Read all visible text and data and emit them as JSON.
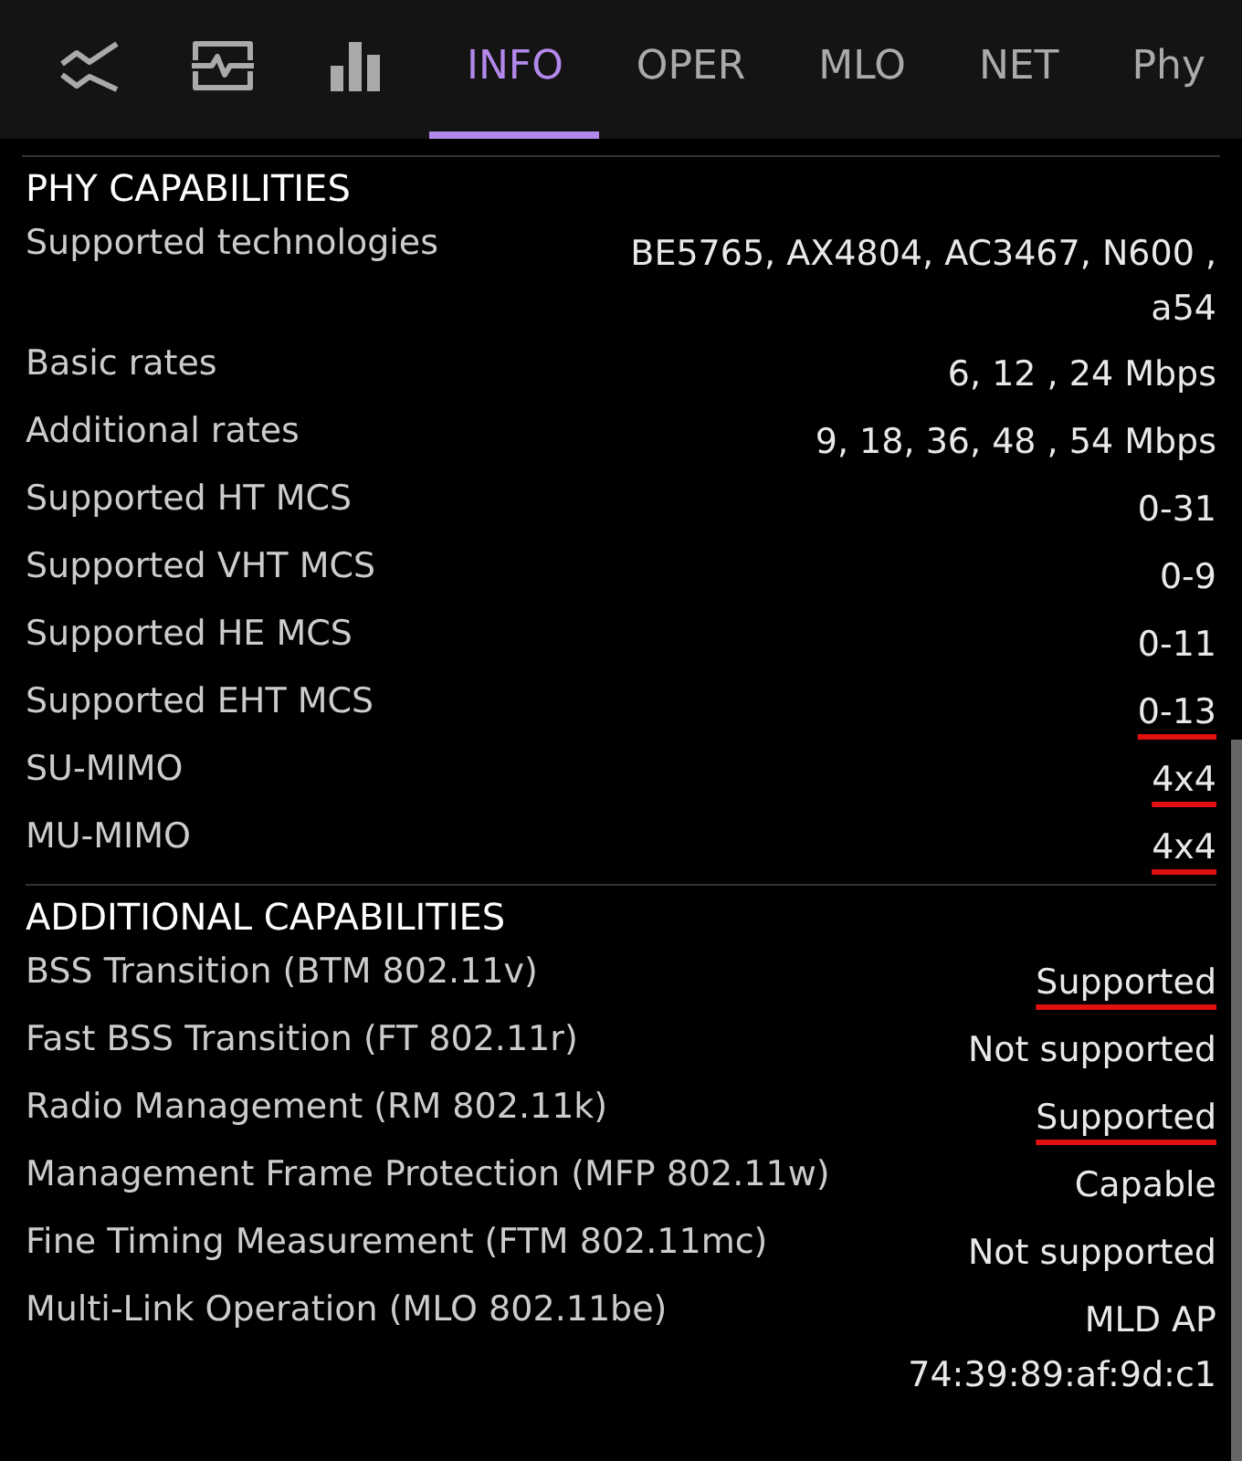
{
  "tabs": [
    {
      "kind": "waves",
      "selected": false
    },
    {
      "kind": "pulse",
      "selected": false
    },
    {
      "kind": "bars",
      "selected": false
    },
    {
      "kind": "text",
      "label": "INFO",
      "selected": true
    },
    {
      "kind": "text",
      "label": "OPER",
      "selected": false
    },
    {
      "kind": "text",
      "label": "MLO",
      "selected": false
    },
    {
      "kind": "text",
      "label": "NET",
      "selected": false
    },
    {
      "kind": "text",
      "label": "Phy",
      "selected": false
    }
  ],
  "sections": [
    {
      "title": "PHY CAPABILITIES",
      "rows": [
        {
          "label": "Supported technologies",
          "values": [
            "BE5765, AX4804, AC3467, N600 , a54"
          ],
          "highlighted": false
        },
        {
          "label": "Basic rates",
          "values": [
            "6, 12 , 24 Mbps"
          ],
          "highlighted": false
        },
        {
          "label": "Additional rates",
          "values": [
            "9, 18, 36, 48 , 54 Mbps"
          ],
          "highlighted": false
        },
        {
          "label": "Supported HT MCS",
          "values": [
            "0-31"
          ],
          "highlighted": false
        },
        {
          "label": "Supported VHT MCS",
          "values": [
            "0-9"
          ],
          "highlighted": false
        },
        {
          "label": "Supported HE MCS",
          "values": [
            "0-11"
          ],
          "highlighted": false
        },
        {
          "label": "Supported EHT MCS",
          "values": [
            "0-13"
          ],
          "highlighted": true
        },
        {
          "label": "SU-MIMO",
          "values": [
            "4x4"
          ],
          "highlighted": true
        },
        {
          "label": "MU-MIMO",
          "values": [
            "4x4"
          ],
          "highlighted": true
        }
      ]
    },
    {
      "title": "ADDITIONAL CAPABILITIES",
      "rows": [
        {
          "label": "BSS Transition (BTM 802.11v)",
          "values": [
            "Supported"
          ],
          "highlighted": true
        },
        {
          "label": "Fast BSS Transition (FT 802.11r)",
          "values": [
            "Not supported"
          ],
          "highlighted": false
        },
        {
          "label": "Radio Management (RM 802.11k)",
          "values": [
            "Supported"
          ],
          "highlighted": true
        },
        {
          "label": "Management Frame Protection (MFP 802.11w)",
          "values": [
            "Capable"
          ],
          "highlighted": false
        },
        {
          "label": "Fine Timing Measurement (FTM 802.11mc)",
          "values": [
            "Not supported"
          ],
          "highlighted": false
        },
        {
          "label": "Multi-Link Operation (MLO 802.11be)",
          "values": [
            "MLD AP",
            "74:39:89:af:9d:c1"
          ],
          "highlighted": false
        }
      ]
    }
  ]
}
